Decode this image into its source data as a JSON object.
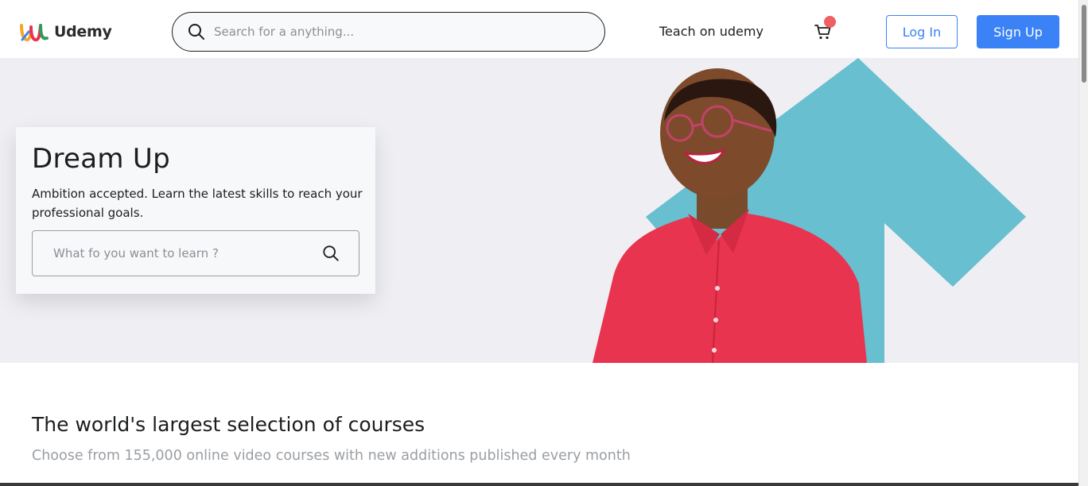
{
  "header": {
    "logo_text": "Udemy",
    "search_placeholder": "Search for a anything...",
    "teach_label": "Teach on udemy",
    "login_label": "Log In",
    "signup_label": "Sign Up"
  },
  "hero": {
    "title": "Dream Up",
    "subtitle": "Ambition accepted. Learn the latest skills to reach your professional goals.",
    "search_placeholder": "What fo you want to learn ?"
  },
  "courses_section": {
    "title": "The world's largest selection of courses",
    "subtitle": "Choose from 155,000 online video courses with new additions published every month"
  },
  "colors": {
    "accent_blue": "#3b82f6",
    "cart_badge": "#f06062",
    "hero_background": "#eeeef3",
    "arrow_teal": "#67bfcf",
    "shirt_red": "#e8344e"
  },
  "icons": [
    "udemy-logo-icon",
    "search-icon",
    "cart-icon",
    "hero-search-icon"
  ]
}
